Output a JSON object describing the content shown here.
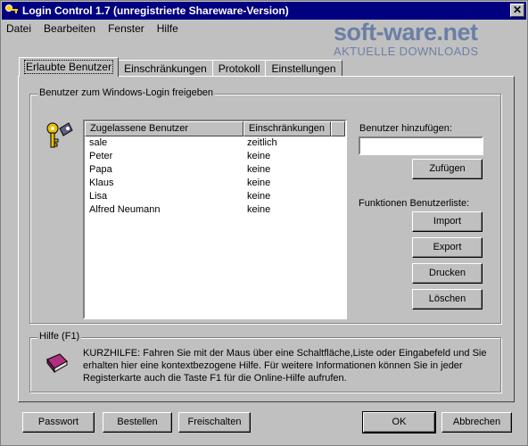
{
  "window": {
    "title": "Login Control 1.7 (unregistrierte Shareware-Version)",
    "close": "✕"
  },
  "menu": [
    "Datei",
    "Bearbeiten",
    "Fenster",
    "Hilfe"
  ],
  "watermark": {
    "main": "soft-ware.net",
    "sub": "AKTUELLE DOWNLOADS"
  },
  "tabs": [
    "Erlaubte Benutzer",
    "Einschränkungen",
    "Protokoll",
    "Einstellungen"
  ],
  "group_users": {
    "label": "Benutzer zum Windows-Login freigeben"
  },
  "users_list": {
    "columns": [
      "Zugelassene Benutzer",
      "Einschränkungen"
    ],
    "rows": [
      [
        "sale",
        "zeitlich"
      ],
      [
        "Peter",
        "keine"
      ],
      [
        "Papa",
        "keine"
      ],
      [
        "Klaus",
        "keine"
      ],
      [
        "Lisa",
        "keine"
      ],
      [
        "Alfred Neumann",
        "keine"
      ]
    ]
  },
  "add_user": {
    "label": "Benutzer hinzufügen:",
    "value": "",
    "button": "Zufügen"
  },
  "list_functions": {
    "label": "Funktionen Benutzerliste:",
    "import": "Import",
    "export": "Export",
    "print": "Drucken",
    "delete": "Löschen"
  },
  "help": {
    "label": "Hilfe (F1)",
    "text": "KURZHILFE: Fahren Sie mit der Maus über eine Schaltfläche,Liste oder Eingabefeld und Sie erhalten hier eine kontextbezogene Hilfe. Für weitere Informationen können Sie in jeder Registerkarte auch die Taste F1 für die Online-Hilfe aufrufen."
  },
  "footer": {
    "password": "Passwort",
    "order": "Bestellen",
    "unlock": "Freischalten",
    "ok": "OK",
    "cancel": "Abbrechen"
  }
}
